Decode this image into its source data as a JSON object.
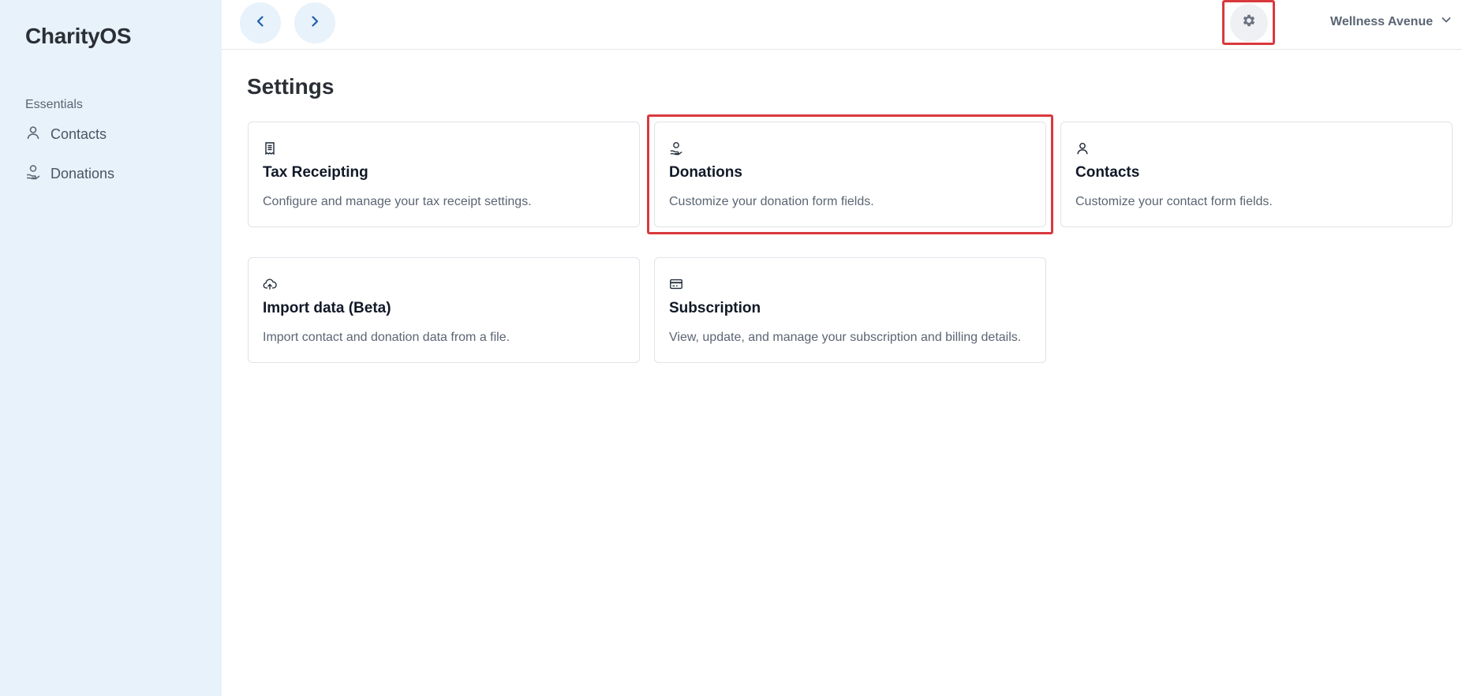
{
  "sidebar": {
    "brand": "CharityOS",
    "section_label": "Essentials",
    "items": [
      {
        "label": "Contacts",
        "icon": "person-icon"
      },
      {
        "label": "Donations",
        "icon": "donation-hand-icon"
      }
    ]
  },
  "topbar": {
    "back_icon": "chevron-left-icon",
    "forward_icon": "chevron-right-icon",
    "settings_icon": "gear-icon",
    "organization": "Wellness Avenue",
    "organization_dropdown_icon": "chevron-down-icon"
  },
  "main": {
    "title": "Settings",
    "cards": [
      {
        "title": "Tax Receipting",
        "description": "Configure and manage your tax receipt settings.",
        "icon": "receipt-icon"
      },
      {
        "title": "Donations",
        "description": "Customize your donation form fields.",
        "icon": "donation-hand-icon"
      },
      {
        "title": "Contacts",
        "description": "Customize your contact form fields.",
        "icon": "person-icon"
      },
      {
        "title": "Import data (Beta)",
        "description": "Import contact and donation data from a file.",
        "icon": "cloud-upload-icon"
      },
      {
        "title": "Subscription",
        "description": "View, update, and manage your subscription and billing details.",
        "icon": "credit-card-icon"
      }
    ]
  },
  "colors": {
    "sidebar_bg": "#e8f2fb",
    "highlight": "#d9393d",
    "accent": "#1e5fa8"
  }
}
